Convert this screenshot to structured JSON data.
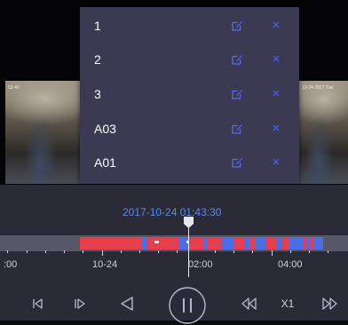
{
  "camera_left": {
    "overlay_text": "03-42"
  },
  "camera_right": {
    "overlay_text": "10-24-2017 Tue"
  },
  "tag_menu": {
    "items": [
      {
        "name": "1"
      },
      {
        "name": "2"
      },
      {
        "name": "3"
      },
      {
        "name": "A03"
      },
      {
        "name": "A01"
      }
    ],
    "delete_glyph": "×"
  },
  "timeline": {
    "current_time": "2017-10-24 01:43:30",
    "tick_labels": [
      ":00",
      "10-24",
      "02:00",
      "04:00"
    ]
  },
  "controls": {
    "speed": "X1"
  },
  "colors": {
    "menu_bg": "#3a3b52",
    "accent_blue": "#4a63ff",
    "record_red": "#e83d4d",
    "record_blue": "#4a6ee6",
    "timestamp": "#5b8be8"
  },
  "icons": {
    "edit": "edit-icon",
    "delete": "close-icon",
    "prev_frame": "step-back-icon",
    "next_frame": "step-forward-icon",
    "reverse": "reverse-play-icon",
    "pause": "pause-icon",
    "slow": "slow-down-icon",
    "fast": "fast-forward-icon"
  }
}
